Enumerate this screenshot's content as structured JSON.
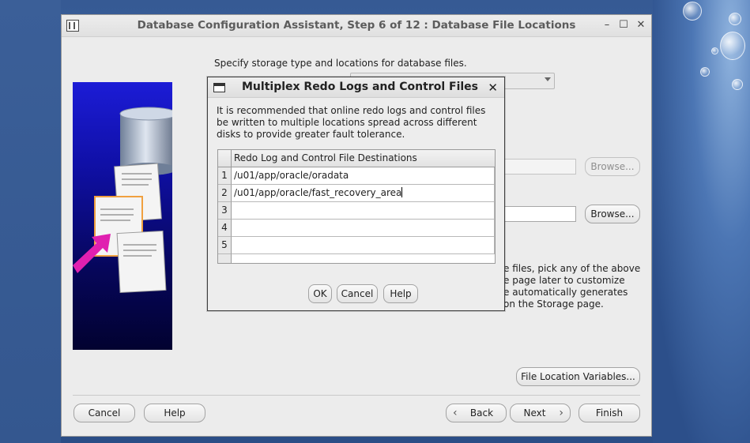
{
  "window": {
    "title": "Database Configuration Assistant, Step 6 of 12 : Database File Locations",
    "controls": {
      "minimize": "–",
      "maximize": "☐",
      "close": "✕"
    }
  },
  "main": {
    "instruction": "Specify storage type and locations for database files.",
    "browse_label_1": "Browse...",
    "browse_label_2": "Browse...",
    "description_lines": [
      "e files, pick any of the above",
      "e page later to customize",
      "e automatically generates",
      "on the Storage page."
    ],
    "file_location_variables": "File Location Variables..."
  },
  "footer": {
    "cancel": "Cancel",
    "help": "Help",
    "back": "Back",
    "next": "Next",
    "finish": "Finish"
  },
  "dialog": {
    "title": "Multiplex Redo Logs and Control Files",
    "close": "✕",
    "message": "It is recommended that online redo logs and control files be written to multiple locations spread across different disks to provide greater fault tolerance.",
    "column_header": "Redo Log and Control File Destinations",
    "rows": [
      {
        "num": "1",
        "value": "/u01/app/oracle/oradata"
      },
      {
        "num": "2",
        "value": "/u01/app/oracle/fast_recovery_area"
      },
      {
        "num": "3",
        "value": ""
      },
      {
        "num": "4",
        "value": ""
      },
      {
        "num": "5",
        "value": ""
      }
    ],
    "ok": "OK",
    "cancel": "Cancel",
    "help": "Help"
  },
  "icons": {
    "app": "app-icon",
    "dialog": "dialog-window-icon",
    "back": "chevron-left-icon",
    "next": "chevron-right-icon"
  }
}
